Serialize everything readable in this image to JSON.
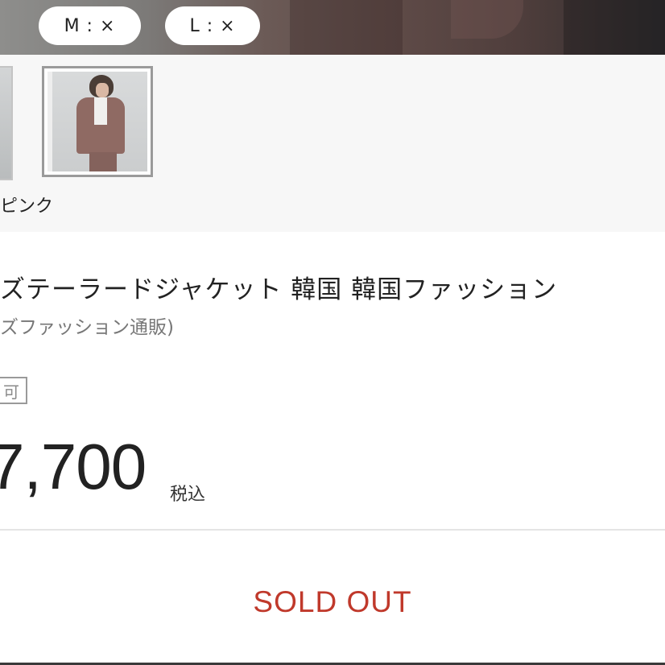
{
  "sizes": [
    {
      "label": "M : ×"
    },
    {
      "label": "L : ×"
    }
  ],
  "thumbnails": {
    "color_label": "ピンク"
  },
  "product": {
    "title": "ズテーラードジャケット 韓国 韓国ファッション",
    "subtitle": "ズファッション通販)",
    "badge": "可",
    "price": "7,700",
    "tax_label": "税込"
  },
  "action": {
    "sold_out_label": "SOLD OUT"
  },
  "colors": {
    "sold_out": "#c0392b",
    "badge_border": "#9a9a9a",
    "subtitle": "#777777"
  }
}
